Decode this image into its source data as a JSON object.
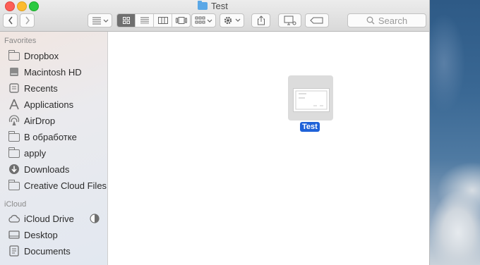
{
  "window": {
    "title": "Test"
  },
  "toolbar": {
    "search_placeholder": "Search"
  },
  "sidebar": {
    "favorites_title": "Favorites",
    "favorites": [
      {
        "label": "Dropbox",
        "icon": "folder-icon"
      },
      {
        "label": "Macintosh HD",
        "icon": "harddisk-icon"
      },
      {
        "label": "Recents",
        "icon": "recents-icon"
      },
      {
        "label": "Applications",
        "icon": "applications-icon"
      },
      {
        "label": "AirDrop",
        "icon": "airdrop-icon"
      },
      {
        "label": "В обработке",
        "icon": "folder-icon"
      },
      {
        "label": "apply",
        "icon": "folder-icon"
      },
      {
        "label": "Downloads",
        "icon": "downloads-icon"
      },
      {
        "label": "Creative Cloud Files",
        "icon": "folder-icon"
      }
    ],
    "icloud_title": "iCloud",
    "icloud": [
      {
        "label": "iCloud Drive",
        "icon": "cloud-icon"
      },
      {
        "label": "Desktop",
        "icon": "desktop-icon"
      },
      {
        "label": "Documents",
        "icon": "documents-icon"
      }
    ]
  },
  "content": {
    "items": [
      {
        "name": "Test",
        "selected": true
      }
    ]
  },
  "colors": {
    "selection": "#1f62d8",
    "folder_accent": "#5aa7e6"
  }
}
